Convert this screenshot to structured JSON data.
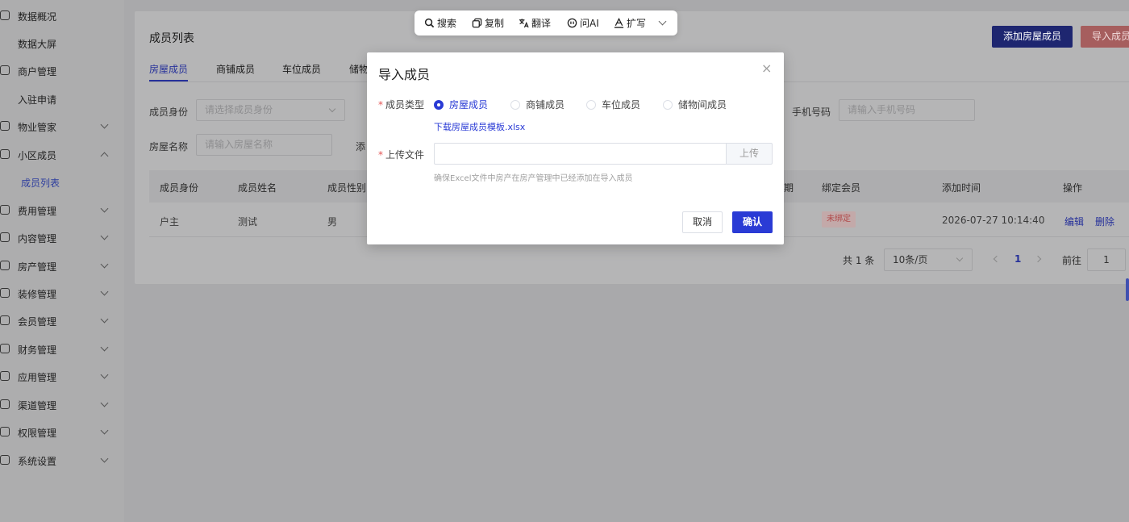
{
  "sidebar": {
    "items": [
      {
        "label": "数据概况",
        "icon": "dashboard-icon",
        "chevron": false
      },
      {
        "label": "数据大屏",
        "icon": "",
        "chevron": false
      },
      {
        "label": "商户管理",
        "icon": "users-icon",
        "chevron": false
      },
      {
        "label": "入驻申请",
        "icon": "",
        "chevron": false
      },
      {
        "label": "物业管家",
        "icon": "butler-icon",
        "chevron": "down"
      },
      {
        "label": "小区成员",
        "icon": "members-icon",
        "chevron": "up"
      },
      {
        "label": "成员列表",
        "icon": "",
        "chevron": false,
        "active": true
      },
      {
        "label": "费用管理",
        "icon": "fee-icon",
        "chevron": "down"
      },
      {
        "label": "内容管理",
        "icon": "content-icon",
        "chevron": "down"
      },
      {
        "label": "房产管理",
        "icon": "house-icon",
        "chevron": "down"
      },
      {
        "label": "装修管理",
        "icon": "renovation-icon",
        "chevron": "down"
      },
      {
        "label": "会员管理",
        "icon": "member-icon",
        "chevron": "down"
      },
      {
        "label": "财务管理",
        "icon": "finance-icon",
        "chevron": "down"
      },
      {
        "label": "应用管理",
        "icon": "app-icon",
        "chevron": "down"
      },
      {
        "label": "渠道管理",
        "icon": "channel-icon",
        "chevron": "down"
      },
      {
        "label": "权限管理",
        "icon": "lock-icon",
        "chevron": "down"
      },
      {
        "label": "系统设置",
        "icon": "gear-icon",
        "chevron": "down"
      }
    ]
  },
  "page": {
    "title": "成员列表",
    "add_button": "添加房屋成员",
    "import_button": "导入成员",
    "tabs": [
      "房屋成员",
      "商铺成员",
      "车位成员",
      "储物"
    ]
  },
  "filters": {
    "identity_label": "成员身份",
    "identity_placeholder": "请选择成员身份",
    "phone_label": "手机号码",
    "phone_placeholder": "请输入手机号码",
    "house_label": "房屋名称",
    "house_placeholder": "请输入房屋名称",
    "add_label_partial": "添"
  },
  "table": {
    "headers": {
      "identity": "成员身份",
      "name": "成员姓名",
      "gender": "成员性别",
      "date_partial": "期",
      "bound": "绑定会员",
      "added": "添加时间",
      "ops": "操作"
    },
    "row": {
      "identity": "户主",
      "name": "测试",
      "gender": "男",
      "bound": "未绑定",
      "added": "2026-07-27 10:14:40",
      "edit": "编辑",
      "delete": "删除"
    }
  },
  "pager": {
    "total": "共 1 条",
    "page_size": "10条/页",
    "current": "1",
    "goto_label": "前往",
    "goto_value": "1"
  },
  "toolbar": {
    "search": "搜索",
    "copy": "复制",
    "translate": "翻译",
    "ask_ai": "问AI",
    "expand": "扩写"
  },
  "modal": {
    "title": "导入成员",
    "close": "×",
    "type_label": "成员类型",
    "required_mark": "*",
    "options": [
      "房屋成员",
      "商铺成员",
      "车位成员",
      "储物间成员"
    ],
    "selected_index": 0,
    "template_link": "下载房屋成员模板.xlsx",
    "file_label": "上传文件",
    "upload_button": "上传",
    "hint": "确保Excel文件中房产在房产管理中已经添加在导入成员",
    "cancel": "取消",
    "confirm": "确认"
  },
  "colors": {
    "primary": "#2a3bd5",
    "danger": "#e45656"
  }
}
